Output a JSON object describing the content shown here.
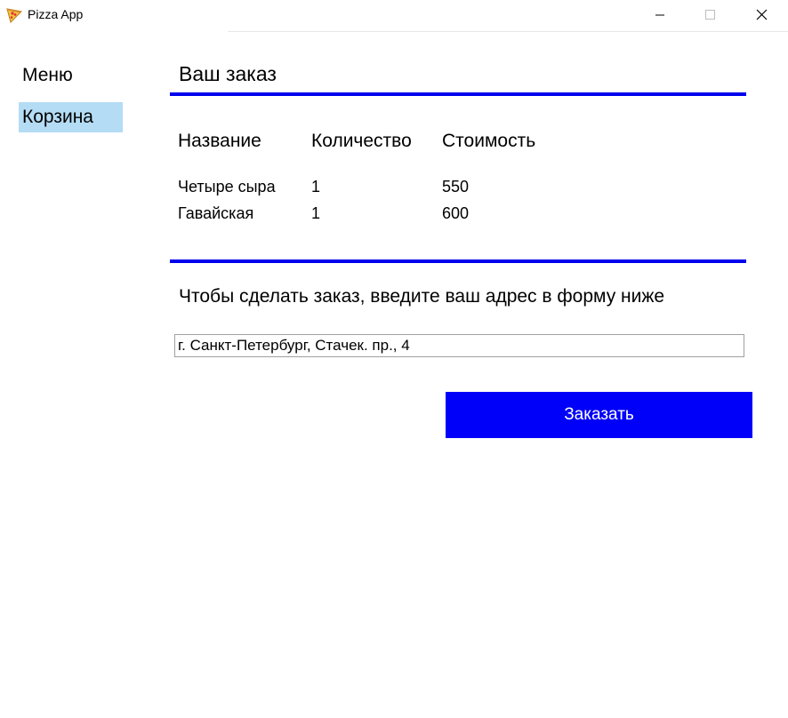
{
  "window": {
    "title": "Pizza App",
    "icon": "pizza-slice-icon",
    "controls": [
      "minimize-icon",
      "maximize-icon",
      "close-icon"
    ]
  },
  "sidebar": {
    "items": [
      {
        "label": "Меню",
        "selected": false
      },
      {
        "label": "Корзина",
        "selected": true
      }
    ],
    "selected_color": "#b4dcf5"
  },
  "main": {
    "title": "Ваш заказ",
    "table": {
      "headers": [
        "Название",
        "Количество",
        "Стоимость"
      ],
      "rows": [
        [
          "Четыре сыра",
          "1",
          "550"
        ],
        [
          "Гавайская",
          "1",
          "600"
        ]
      ]
    },
    "instruction": "Чтобы сделать заказ, введите ваш адрес в форму ниже",
    "address": {
      "value": "г. Санкт-Петербург, Стачек. пр., 4",
      "placeholder": ""
    },
    "order_button": "Заказать",
    "accent_color": "#0000ee"
  }
}
